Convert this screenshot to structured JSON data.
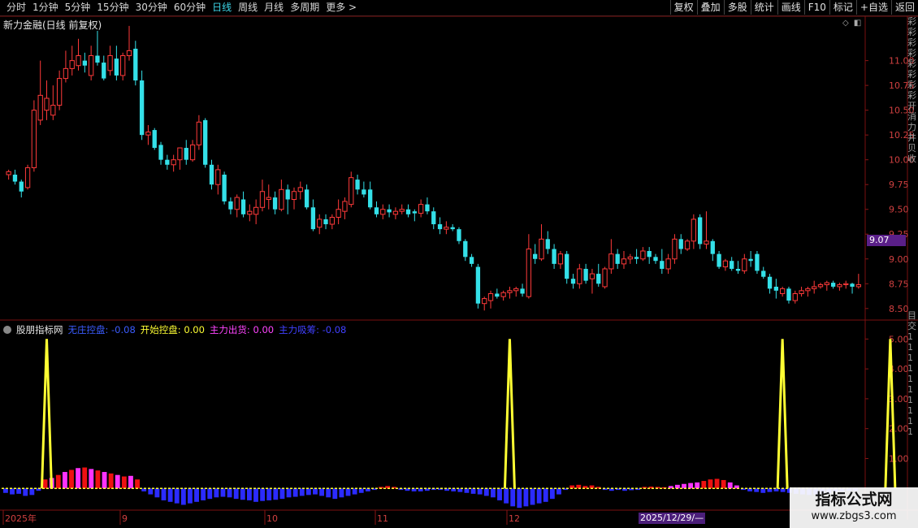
{
  "toolbar": {
    "tabs": [
      "分时",
      "1分钟",
      "5分钟",
      "15分钟",
      "30分钟",
      "60分钟",
      "日线",
      "周线",
      "月线",
      "多周期",
      "更多 >"
    ],
    "active_tab": "日线",
    "right_buttons": [
      "复权",
      "叠加",
      "多股",
      "统计",
      "画线",
      "F10",
      "标记",
      "+自选",
      "返回"
    ]
  },
  "chart_title": "新力金融(日线 前复权)",
  "price_axis": {
    "ticks": [
      "11.00",
      "10.75",
      "10.50",
      "10.25",
      "10.00",
      "9.75",
      "9.50",
      "9.25",
      "9.00",
      "8.75",
      "8.50"
    ],
    "current_price": "9.07"
  },
  "indicator": {
    "name": "股朋指标网",
    "items": [
      {
        "label": "无庄控盘:",
        "value": "-0.08",
        "color": "#3b5cff"
      },
      {
        "label": "开始控盘:",
        "value": "0.00",
        "color": "#ffff33"
      },
      {
        "label": "主力出货:",
        "value": "0.00",
        "color": "#ff44ff"
      },
      {
        "label": "主力吸筹:",
        "value": "-0.08",
        "color": "#4040ff"
      }
    ],
    "axis_ticks": [
      "5.00",
      "4.00",
      "3.00",
      "2.00",
      "1.00"
    ]
  },
  "date_axis": {
    "labels": [
      "2025年",
      "9",
      "10",
      "11",
      "12"
    ],
    "cursor_date": "2025/12/29/—"
  },
  "right_strip_text": [
    "彩",
    "彩",
    "彩",
    "彩",
    "彩",
    "彩",
    "彩",
    "彩",
    "开",
    "消",
    "力",
    "井",
    "贝",
    "收"
  ],
  "right_strip_lower": [
    "目",
    "交",
    "1",
    "1",
    "1",
    "1",
    "1",
    "1",
    "1",
    "1",
    "1",
    "1"
  ],
  "watermark": {
    "title": "指标公式网",
    "url": "www.zbgs3.com"
  },
  "colors": {
    "up": "#ff3a3a",
    "down": "#34e0e8",
    "spike": "#ffff33",
    "blue_bar": "#2b2bff",
    "red_bar": "#ee1111",
    "magenta_bar": "#ff33ff"
  },
  "chart_data": {
    "type": "candlestick",
    "ylim": [
      8.4,
      11.3
    ],
    "candles": [
      [
        9.85,
        9.9,
        9.8,
        9.88
      ],
      [
        9.85,
        9.9,
        9.75,
        9.78
      ],
      [
        9.78,
        9.8,
        9.62,
        9.68
      ],
      [
        9.72,
        9.95,
        9.7,
        9.92
      ],
      [
        9.92,
        10.6,
        9.88,
        10.5
      ],
      [
        10.4,
        11.0,
        10.35,
        10.65
      ],
      [
        10.5,
        10.8,
        10.4,
        10.62
      ],
      [
        10.45,
        10.75,
        10.4,
        10.55
      ],
      [
        10.55,
        10.9,
        10.5,
        10.82
      ],
      [
        10.82,
        11.1,
        10.78,
        10.92
      ],
      [
        10.92,
        11.15,
        10.85,
        11.0
      ],
      [
        10.95,
        11.22,
        10.9,
        11.05
      ],
      [
        11.0,
        11.08,
        10.88,
        10.95
      ],
      [
        10.85,
        11.15,
        10.8,
        11.05
      ],
      [
        11.05,
        11.3,
        10.95,
        10.98
      ],
      [
        10.98,
        11.05,
        10.8,
        10.82
      ],
      [
        10.9,
        11.15,
        10.85,
        11.05
      ],
      [
        11.02,
        11.15,
        10.8,
        10.85
      ],
      [
        10.85,
        11.08,
        10.8,
        11.05
      ],
      [
        11.05,
        11.35,
        11.0,
        11.1
      ],
      [
        11.12,
        11.2,
        10.75,
        10.8
      ],
      [
        10.8,
        10.9,
        10.2,
        10.25
      ],
      [
        10.25,
        10.35,
        10.15,
        10.28
      ],
      [
        10.3,
        10.32,
        10.1,
        10.12
      ],
      [
        10.15,
        10.18,
        9.95,
        10.0
      ],
      [
        10.0,
        10.05,
        9.9,
        9.95
      ],
      [
        9.95,
        10.05,
        9.88,
        10.0
      ],
      [
        10.0,
        10.1,
        9.9,
        10.12
      ],
      [
        10.12,
        10.2,
        9.95,
        10.0
      ],
      [
        10.0,
        10.2,
        9.98,
        10.15
      ],
      [
        10.15,
        10.45,
        10.1,
        10.38
      ],
      [
        10.4,
        10.42,
        9.92,
        9.95
      ],
      [
        9.95,
        10.0,
        9.7,
        9.75
      ],
      [
        9.75,
        9.95,
        9.65,
        9.9
      ],
      [
        9.85,
        9.88,
        9.55,
        9.58
      ],
      [
        9.58,
        9.62,
        9.45,
        9.5
      ],
      [
        9.5,
        9.65,
        9.42,
        9.62
      ],
      [
        9.6,
        9.68,
        9.42,
        9.45
      ],
      [
        9.45,
        9.55,
        9.38,
        9.48
      ],
      [
        9.45,
        9.6,
        9.35,
        9.52
      ],
      [
        9.52,
        9.8,
        9.48,
        9.68
      ],
      [
        9.6,
        9.75,
        9.5,
        9.62
      ],
      [
        9.62,
        9.68,
        9.45,
        9.5
      ],
      [
        9.5,
        9.8,
        9.48,
        9.7
      ],
      [
        9.7,
        9.75,
        9.45,
        9.6
      ],
      [
        9.6,
        9.72,
        9.5,
        9.68
      ],
      [
        9.68,
        9.78,
        9.6,
        9.72
      ],
      [
        9.7,
        9.75,
        9.5,
        9.52
      ],
      [
        9.52,
        9.6,
        9.28,
        9.3
      ],
      [
        9.32,
        9.45,
        9.25,
        9.4
      ],
      [
        9.4,
        9.45,
        9.3,
        9.35
      ],
      [
        9.35,
        9.45,
        9.3,
        9.42
      ],
      [
        9.42,
        9.6,
        9.35,
        9.5
      ],
      [
        9.48,
        9.62,
        9.4,
        9.58
      ],
      [
        9.55,
        9.88,
        9.52,
        9.82
      ],
      [
        9.8,
        9.85,
        9.65,
        9.7
      ],
      [
        9.7,
        9.78,
        9.62,
        9.65
      ],
      [
        9.7,
        9.78,
        9.5,
        9.52
      ],
      [
        9.52,
        9.58,
        9.42,
        9.45
      ],
      [
        9.45,
        9.55,
        9.4,
        9.5
      ],
      [
        9.5,
        9.55,
        9.42,
        9.47
      ],
      [
        9.45,
        9.52,
        9.4,
        9.48
      ],
      [
        9.48,
        9.55,
        9.45,
        9.5
      ],
      [
        9.5,
        9.55,
        9.42,
        9.45
      ],
      [
        9.48,
        9.5,
        9.38,
        9.46
      ],
      [
        9.46,
        9.6,
        9.42,
        9.55
      ],
      [
        9.55,
        9.62,
        9.45,
        9.48
      ],
      [
        9.48,
        9.52,
        9.3,
        9.35
      ],
      [
        9.35,
        9.42,
        9.25,
        9.3
      ],
      [
        9.3,
        9.38,
        9.25,
        9.32
      ],
      [
        9.32,
        9.35,
        9.28,
        9.3
      ],
      [
        9.3,
        9.32,
        9.15,
        9.18
      ],
      [
        9.18,
        9.2,
        8.98,
        9.02
      ],
      [
        9.02,
        9.05,
        8.92,
        8.95
      ],
      [
        8.92,
        8.95,
        8.5,
        8.55
      ],
      [
        8.55,
        8.62,
        8.48,
        8.6
      ],
      [
        8.58,
        8.68,
        8.5,
        8.65
      ],
      [
        8.65,
        8.7,
        8.6,
        8.62
      ],
      [
        8.62,
        8.68,
        8.58,
        8.66
      ],
      [
        8.66,
        8.72,
        8.6,
        8.68
      ],
      [
        8.68,
        8.72,
        8.62,
        8.7
      ],
      [
        8.7,
        8.75,
        8.62,
        8.65
      ],
      [
        8.62,
        9.25,
        8.6,
        9.1
      ],
      [
        9.05,
        9.15,
        8.95,
        9.0
      ],
      [
        9.0,
        9.35,
        8.98,
        9.2
      ],
      [
        9.2,
        9.28,
        9.05,
        9.1
      ],
      [
        9.1,
        9.15,
        8.9,
        8.95
      ],
      [
        8.95,
        9.08,
        8.9,
        9.05
      ],
      [
        9.05,
        9.08,
        8.75,
        8.8
      ],
      [
        8.8,
        8.85,
        8.7,
        8.75
      ],
      [
        8.75,
        8.95,
        8.7,
        8.9
      ],
      [
        8.9,
        8.95,
        8.75,
        8.78
      ],
      [
        8.8,
        8.9,
        8.65,
        8.85
      ],
      [
        8.85,
        8.95,
        8.72,
        8.75
      ],
      [
        8.72,
        8.92,
        8.7,
        8.9
      ],
      [
        8.9,
        9.2,
        8.85,
        9.05
      ],
      [
        9.05,
        9.1,
        8.9,
        8.95
      ],
      [
        8.95,
        9.08,
        8.9,
        9.0
      ],
      [
        9.0,
        9.05,
        8.95,
        9.02
      ],
      [
        9.02,
        9.1,
        8.95,
        9.0
      ],
      [
        9.0,
        9.12,
        8.98,
        9.08
      ],
      [
        9.08,
        9.12,
        8.95,
        9.02
      ],
      [
        9.02,
        9.05,
        8.95,
        8.98
      ],
      [
        8.98,
        9.1,
        8.85,
        8.9
      ],
      [
        8.9,
        9.05,
        8.85,
        9.0
      ],
      [
        9.0,
        9.25,
        8.95,
        9.2
      ],
      [
        9.2,
        9.25,
        9.05,
        9.1
      ],
      [
        9.1,
        9.2,
        9.08,
        9.18
      ],
      [
        9.18,
        9.45,
        9.1,
        9.4
      ],
      [
        9.42,
        9.45,
        9.1,
        9.15
      ],
      [
        9.15,
        9.48,
        9.1,
        9.18
      ],
      [
        9.18,
        9.2,
        8.98,
        9.05
      ],
      [
        9.05,
        9.08,
        8.9,
        8.92
      ],
      [
        8.92,
        9.0,
        8.88,
        8.98
      ],
      [
        8.98,
        9.02,
        8.88,
        8.9
      ],
      [
        8.9,
        8.98,
        8.85,
        8.88
      ],
      [
        8.88,
        9.05,
        8.85,
        9.0
      ],
      [
        9.0,
        9.08,
        8.92,
        8.98
      ],
      [
        9.05,
        9.08,
        8.85,
        8.88
      ],
      [
        8.88,
        8.92,
        8.8,
        8.82
      ],
      [
        8.82,
        8.85,
        8.65,
        8.7
      ],
      [
        8.72,
        8.8,
        8.6,
        8.68
      ],
      [
        8.65,
        8.72,
        8.62,
        8.7
      ],
      [
        8.7,
        8.72,
        8.55,
        8.58
      ],
      [
        8.58,
        8.68,
        8.55,
        8.65
      ],
      [
        8.65,
        8.72,
        8.62,
        8.68
      ],
      [
        8.68,
        8.72,
        8.62,
        8.7
      ],
      [
        8.7,
        8.78,
        8.65,
        8.72
      ],
      [
        8.72,
        8.76,
        8.7,
        8.74
      ],
      [
        8.74,
        8.78,
        8.68,
        8.76
      ],
      [
        8.76,
        8.78,
        8.7,
        8.72
      ],
      [
        8.72,
        8.76,
        8.68,
        8.74
      ],
      [
        8.74,
        8.78,
        8.7,
        8.75
      ],
      [
        8.75,
        8.76,
        8.65,
        8.72
      ],
      [
        8.72,
        8.85,
        8.7,
        8.74
      ]
    ],
    "spikes_at_index": [
      6,
      79,
      122,
      139
    ],
    "spike_value": 5.0,
    "indicator_ylim": [
      -0.7,
      5.2
    ],
    "bars": [
      [
        -0.15,
        -0.2,
        -0.18,
        -0.25,
        -0.22,
        -0.08,
        0.3,
        0.35,
        0.45,
        0.55,
        0.62,
        0.68,
        0.7,
        0.65,
        0.6,
        0.55,
        0.5,
        0.45,
        0.4,
        0.42,
        0.3,
        -0.1,
        -0.2,
        -0.3,
        -0.4,
        -0.45,
        -0.5,
        -0.55,
        -0.5,
        -0.45,
        -0.4,
        -0.35,
        -0.3,
        -0.28,
        -0.3,
        -0.35,
        -0.38,
        -0.4,
        -0.45,
        -0.42,
        -0.4,
        -0.38,
        -0.35,
        -0.3,
        -0.28,
        -0.25,
        -0.22,
        -0.2,
        -0.25,
        -0.3,
        -0.35,
        -0.3,
        -0.25,
        -0.2,
        -0.15,
        -0.1,
        -0.05,
        0.05,
        0.08,
        0.05,
        -0.05,
        -0.08,
        -0.1,
        -0.1,
        -0.08,
        -0.05,
        -0.05,
        -0.08,
        -0.1,
        -0.12,
        -0.15,
        -0.18,
        -0.2,
        -0.25,
        -0.3,
        -0.4,
        -0.5,
        -0.6,
        -0.65,
        -0.6,
        -0.55,
        -0.5,
        -0.45,
        -0.35,
        -0.2,
        -0.05,
        0.1,
        0.12,
        0.08,
        0.1,
        0.05,
        -0.05,
        -0.08,
        -0.05,
        -0.08,
        -0.06,
        -0.05,
        0.05,
        0.06,
        0.05,
        0.04,
        0.08,
        0.12,
        0.15,
        0.18,
        0.2,
        0.25,
        0.3,
        0.32,
        0.28,
        0.2,
        0.1,
        -0.05,
        -0.1,
        -0.12,
        -0.15,
        -0.12,
        -0.1,
        -0.12,
        -0.15,
        -0.18,
        -0.2,
        -0.22,
        -0.2,
        -0.18,
        -0.15,
        -0.12,
        -0.1,
        -0.08,
        -0.08
      ]
    ]
  }
}
